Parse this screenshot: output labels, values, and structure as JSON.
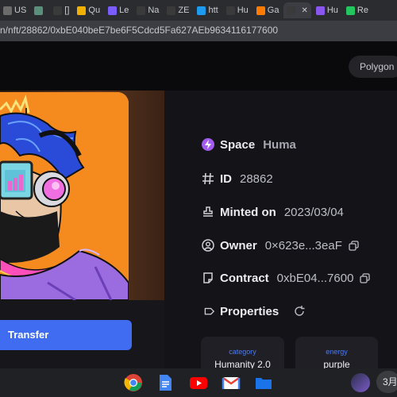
{
  "browser": {
    "tabs": [
      {
        "label": "US",
        "color": "#6b6b6b",
        "active": false
      },
      {
        "label": "",
        "color": "#5a8f7b",
        "active": false
      },
      {
        "label": "[]",
        "color": "#3a3a3a",
        "active": false
      },
      {
        "label": "Qu",
        "color": "#f2b100",
        "active": false
      },
      {
        "label": "Le",
        "color": "#7b5cff",
        "active": false
      },
      {
        "label": "Na",
        "color": "#3a3a3a",
        "active": false
      },
      {
        "label": "ZE",
        "color": "#3a3a3a",
        "active": false
      },
      {
        "label": "htt",
        "color": "#1d9bf0",
        "active": false
      },
      {
        "label": "Hu",
        "color": "#3a3a3a",
        "active": false
      },
      {
        "label": "Ga",
        "color": "#ff7a00",
        "active": false
      },
      {
        "label": "",
        "color": "#3a3a3a",
        "active": true,
        "close": "✕"
      },
      {
        "label": "Hu",
        "color": "#8a56f0",
        "active": false
      },
      {
        "label": "Re",
        "color": "#22c55e",
        "active": false
      }
    ],
    "url": "n/nft/28862/0xbE040beE7be6F5Cdcd5Fa627AEb9634116177600"
  },
  "header": {
    "chain_label": "Polygon"
  },
  "details": {
    "space_label": "Space",
    "space_value": "Huma",
    "id_label": "ID",
    "id_value": "28862",
    "minted_label": "Minted on",
    "minted_value": "2023/03/04",
    "owner_label": "Owner",
    "owner_value": "0×623e...3eaF",
    "contract_label": "Contract",
    "contract_value": "0xbE04...7600",
    "properties_label": "Properties"
  },
  "properties": [
    {
      "type": "category",
      "value": "Humanity 2.0"
    },
    {
      "type": "energy",
      "value": "purple"
    }
  ],
  "actions": {
    "transfer_label": "Transfer"
  },
  "taskbar": {
    "apps": [
      "chrome-icon",
      "docs-icon",
      "youtube-icon",
      "gmail-icon",
      "files-icon"
    ],
    "clock": "3月"
  },
  "colors": {
    "accent": "#3f6cf0",
    "property_type": "#4b7bf5",
    "space_icon": "#a35cf0",
    "artwork_bg": "#f58a1f"
  }
}
